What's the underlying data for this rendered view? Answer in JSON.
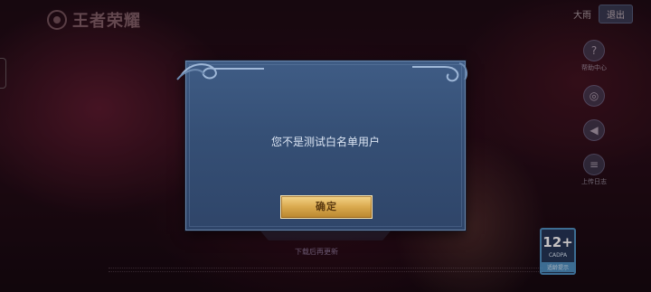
{
  "app": {
    "logo_text": "王者荣耀",
    "username": "大雨",
    "logout_label": "退出"
  },
  "side_menu": {
    "items": [
      {
        "icon": "help-icon",
        "glyph": "?",
        "label": "帮助中心"
      },
      {
        "icon": "gamepad-icon",
        "glyph": "◎",
        "label": ""
      },
      {
        "icon": "speaker-icon",
        "glyph": "◀",
        "label": ""
      },
      {
        "icon": "notes-icon",
        "glyph": "≡",
        "label": "上传日志"
      }
    ]
  },
  "footer": {
    "download_link": "下载后再更新",
    "age_rating": "12+",
    "age_rating_label": "CADPA",
    "age_rating_sub": "适龄提示"
  },
  "dialog": {
    "message": "您不是测试白名单用户",
    "confirm_label": "确定"
  },
  "colors": {
    "dialog_bg": "#3a5680",
    "dialog_border": "#6a86aa",
    "button_gold": "#d9a94e",
    "button_text": "#5b3a10",
    "message_text": "#dce6f4"
  }
}
